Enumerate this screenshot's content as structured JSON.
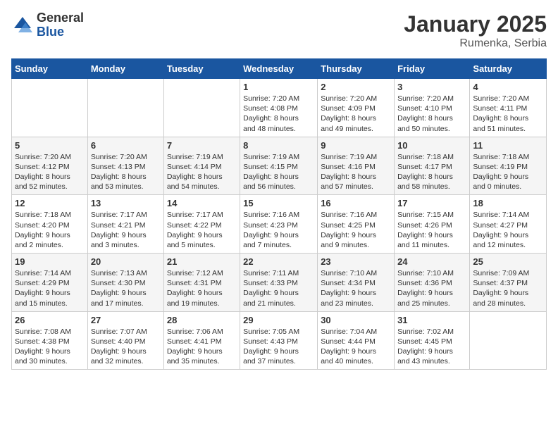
{
  "logo": {
    "general": "General",
    "blue": "Blue"
  },
  "title": "January 2025",
  "location": "Rumenka, Serbia",
  "days_header": [
    "Sunday",
    "Monday",
    "Tuesday",
    "Wednesday",
    "Thursday",
    "Friday",
    "Saturday"
  ],
  "weeks": [
    [
      {
        "day": "",
        "info": ""
      },
      {
        "day": "",
        "info": ""
      },
      {
        "day": "",
        "info": ""
      },
      {
        "day": "1",
        "info": "Sunrise: 7:20 AM\nSunset: 4:08 PM\nDaylight: 8 hours\nand 48 minutes."
      },
      {
        "day": "2",
        "info": "Sunrise: 7:20 AM\nSunset: 4:09 PM\nDaylight: 8 hours\nand 49 minutes."
      },
      {
        "day": "3",
        "info": "Sunrise: 7:20 AM\nSunset: 4:10 PM\nDaylight: 8 hours\nand 50 minutes."
      },
      {
        "day": "4",
        "info": "Sunrise: 7:20 AM\nSunset: 4:11 PM\nDaylight: 8 hours\nand 51 minutes."
      }
    ],
    [
      {
        "day": "5",
        "info": "Sunrise: 7:20 AM\nSunset: 4:12 PM\nDaylight: 8 hours\nand 52 minutes."
      },
      {
        "day": "6",
        "info": "Sunrise: 7:20 AM\nSunset: 4:13 PM\nDaylight: 8 hours\nand 53 minutes."
      },
      {
        "day": "7",
        "info": "Sunrise: 7:19 AM\nSunset: 4:14 PM\nDaylight: 8 hours\nand 54 minutes."
      },
      {
        "day": "8",
        "info": "Sunrise: 7:19 AM\nSunset: 4:15 PM\nDaylight: 8 hours\nand 56 minutes."
      },
      {
        "day": "9",
        "info": "Sunrise: 7:19 AM\nSunset: 4:16 PM\nDaylight: 8 hours\nand 57 minutes."
      },
      {
        "day": "10",
        "info": "Sunrise: 7:18 AM\nSunset: 4:17 PM\nDaylight: 8 hours\nand 58 minutes."
      },
      {
        "day": "11",
        "info": "Sunrise: 7:18 AM\nSunset: 4:19 PM\nDaylight: 9 hours\nand 0 minutes."
      }
    ],
    [
      {
        "day": "12",
        "info": "Sunrise: 7:18 AM\nSunset: 4:20 PM\nDaylight: 9 hours\nand 2 minutes."
      },
      {
        "day": "13",
        "info": "Sunrise: 7:17 AM\nSunset: 4:21 PM\nDaylight: 9 hours\nand 3 minutes."
      },
      {
        "day": "14",
        "info": "Sunrise: 7:17 AM\nSunset: 4:22 PM\nDaylight: 9 hours\nand 5 minutes."
      },
      {
        "day": "15",
        "info": "Sunrise: 7:16 AM\nSunset: 4:23 PM\nDaylight: 9 hours\nand 7 minutes."
      },
      {
        "day": "16",
        "info": "Sunrise: 7:16 AM\nSunset: 4:25 PM\nDaylight: 9 hours\nand 9 minutes."
      },
      {
        "day": "17",
        "info": "Sunrise: 7:15 AM\nSunset: 4:26 PM\nDaylight: 9 hours\nand 11 minutes."
      },
      {
        "day": "18",
        "info": "Sunrise: 7:14 AM\nSunset: 4:27 PM\nDaylight: 9 hours\nand 12 minutes."
      }
    ],
    [
      {
        "day": "19",
        "info": "Sunrise: 7:14 AM\nSunset: 4:29 PM\nDaylight: 9 hours\nand 15 minutes."
      },
      {
        "day": "20",
        "info": "Sunrise: 7:13 AM\nSunset: 4:30 PM\nDaylight: 9 hours\nand 17 minutes."
      },
      {
        "day": "21",
        "info": "Sunrise: 7:12 AM\nSunset: 4:31 PM\nDaylight: 9 hours\nand 19 minutes."
      },
      {
        "day": "22",
        "info": "Sunrise: 7:11 AM\nSunset: 4:33 PM\nDaylight: 9 hours\nand 21 minutes."
      },
      {
        "day": "23",
        "info": "Sunrise: 7:10 AM\nSunset: 4:34 PM\nDaylight: 9 hours\nand 23 minutes."
      },
      {
        "day": "24",
        "info": "Sunrise: 7:10 AM\nSunset: 4:36 PM\nDaylight: 9 hours\nand 25 minutes."
      },
      {
        "day": "25",
        "info": "Sunrise: 7:09 AM\nSunset: 4:37 PM\nDaylight: 9 hours\nand 28 minutes."
      }
    ],
    [
      {
        "day": "26",
        "info": "Sunrise: 7:08 AM\nSunset: 4:38 PM\nDaylight: 9 hours\nand 30 minutes."
      },
      {
        "day": "27",
        "info": "Sunrise: 7:07 AM\nSunset: 4:40 PM\nDaylight: 9 hours\nand 32 minutes."
      },
      {
        "day": "28",
        "info": "Sunrise: 7:06 AM\nSunset: 4:41 PM\nDaylight: 9 hours\nand 35 minutes."
      },
      {
        "day": "29",
        "info": "Sunrise: 7:05 AM\nSunset: 4:43 PM\nDaylight: 9 hours\nand 37 minutes."
      },
      {
        "day": "30",
        "info": "Sunrise: 7:04 AM\nSunset: 4:44 PM\nDaylight: 9 hours\nand 40 minutes."
      },
      {
        "day": "31",
        "info": "Sunrise: 7:02 AM\nSunset: 4:45 PM\nDaylight: 9 hours\nand 43 minutes."
      },
      {
        "day": "",
        "info": ""
      }
    ]
  ]
}
